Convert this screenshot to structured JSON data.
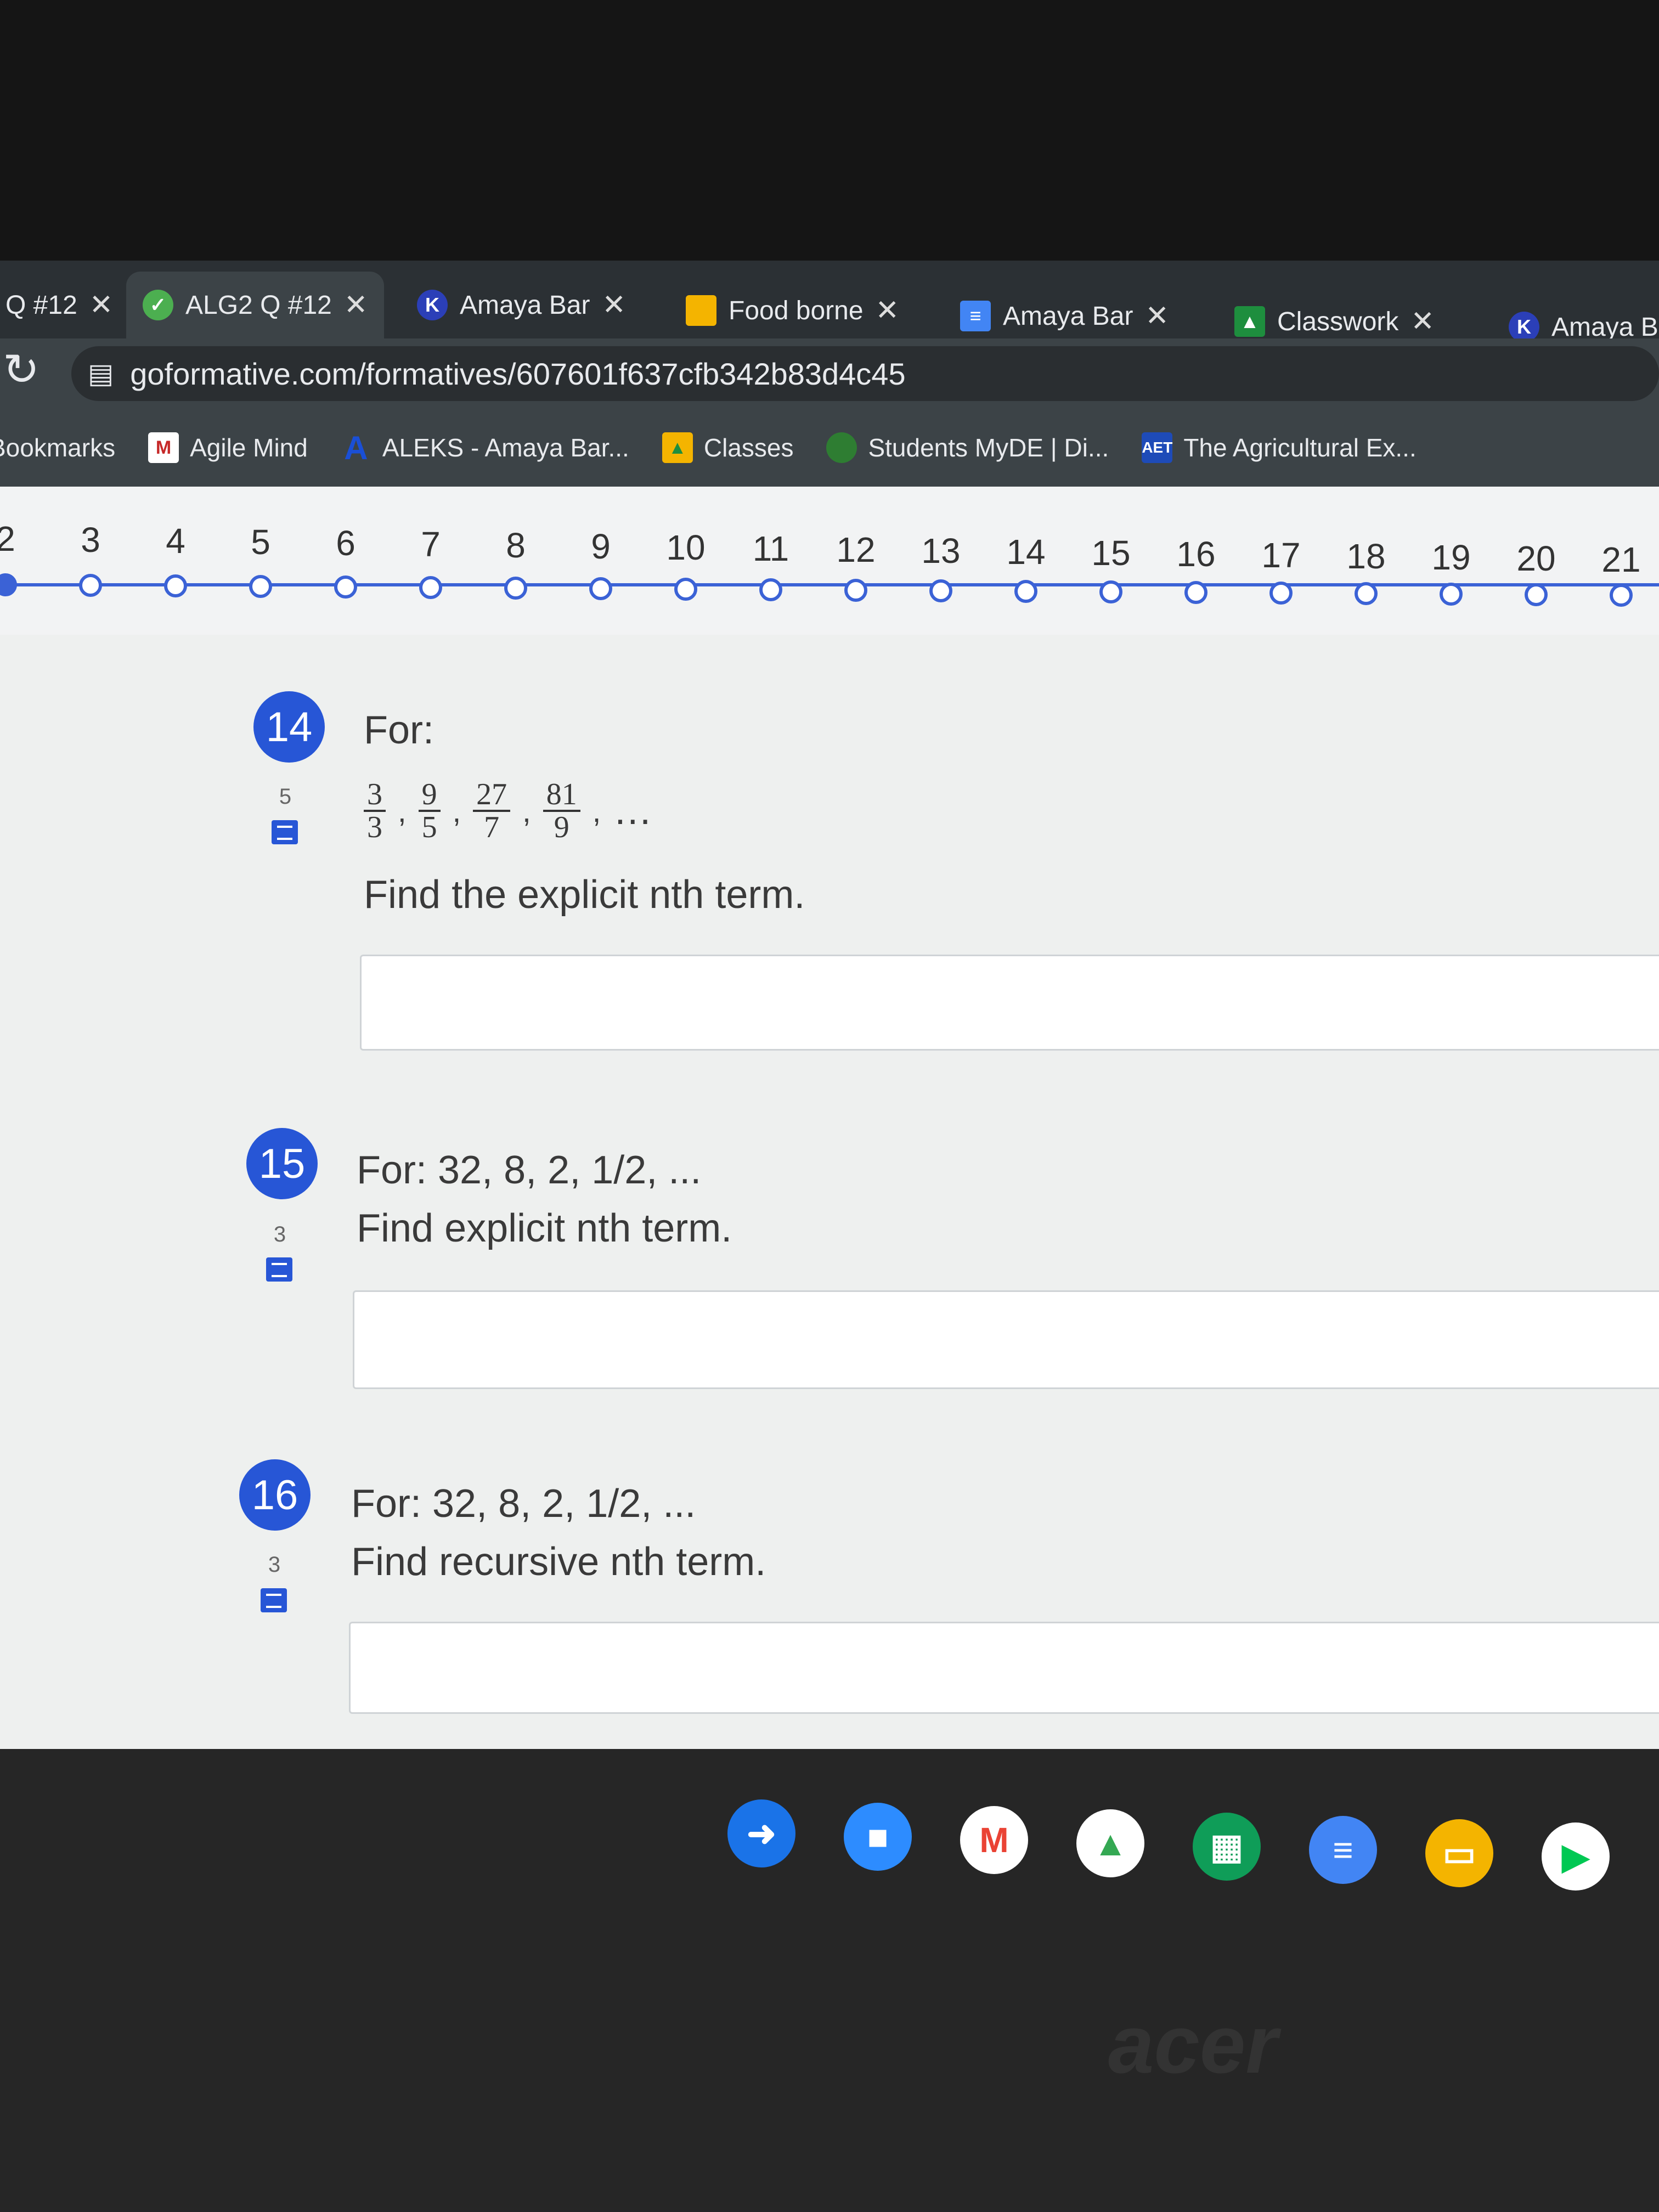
{
  "tabs": [
    {
      "label": "Q #12",
      "icon": "formative-icon",
      "color": "#2b3034"
    },
    {
      "label": "ALG2 Q #12",
      "icon": "formative-icon",
      "color": "#4caf50",
      "active": true
    },
    {
      "label": "Amaya Bar",
      "icon": "k-icon",
      "color": "#2b3fb8"
    },
    {
      "label": "Food borne",
      "icon": "slides-icon",
      "color": "#f4b400"
    },
    {
      "label": "Amaya Bar",
      "icon": "docs-icon",
      "color": "#4285f4"
    },
    {
      "label": "Classwork",
      "icon": "classroom-icon",
      "color": "#1e8e3e"
    },
    {
      "label": "Amaya B",
      "icon": "k-icon",
      "color": "#2b3fb8"
    }
  ],
  "address": {
    "url": "goformative.com/formatives/607601f637cfb342b83d4c45"
  },
  "bookmarks": [
    {
      "label": "Bookmarks",
      "icon": "folder-icon"
    },
    {
      "label": "Agile Mind",
      "icon": "agile-mind-icon",
      "color": "#c62828"
    },
    {
      "label": "ALEKS - Amaya Bar...",
      "icon": "aleks-icon",
      "color": "#1a4fd6"
    },
    {
      "label": "Classes",
      "icon": "classroom-icon",
      "color": "#f4b400"
    },
    {
      "label": "Students MyDE | Di...",
      "icon": "globe-icon",
      "color": "#2e7d32"
    },
    {
      "label": "The Agricultural Ex...",
      "icon": "aet-icon",
      "color": "#1e4bb8"
    }
  ],
  "question_nav": {
    "numbers": [
      "2",
      "3",
      "4",
      "5",
      "6",
      "7",
      "8",
      "9",
      "10",
      "11",
      "12",
      "13",
      "14",
      "15",
      "16",
      "17",
      "18",
      "19",
      "20",
      "21"
    ],
    "accent": "#3b62d6"
  },
  "questions": [
    {
      "number": "14",
      "points": "5",
      "prompt": "For:",
      "fractions": [
        [
          "3",
          "3"
        ],
        [
          "9",
          "5"
        ],
        [
          "27",
          "7"
        ],
        [
          "81",
          "9"
        ]
      ],
      "ellipsis": "…",
      "instruction": "Find the explicit nth term."
    },
    {
      "number": "15",
      "points": "3",
      "prompt": "For: 32, 8, 2, 1/2, ...",
      "instruction": "Find explicit nth term."
    },
    {
      "number": "16",
      "points": "3",
      "prompt": "For: 32, 8, 2, 1/2, ...",
      "instruction": "Find recursive nth term."
    }
  ],
  "shelf": [
    {
      "icon": "launcher-arrow-icon",
      "color": "#1a73e8"
    },
    {
      "icon": "zoom-icon",
      "color": "#2d8cff"
    },
    {
      "icon": "gmail-icon",
      "color": "#ea4335"
    },
    {
      "icon": "drive-icon",
      "color": "#34a853"
    },
    {
      "icon": "sheets-icon",
      "color": "#0f9d58"
    },
    {
      "icon": "docs-icon",
      "color": "#4285f4"
    },
    {
      "icon": "slides-icon",
      "color": "#f4b400"
    },
    {
      "icon": "play-store-icon",
      "color": "#00c853"
    }
  ],
  "brand": "acer"
}
